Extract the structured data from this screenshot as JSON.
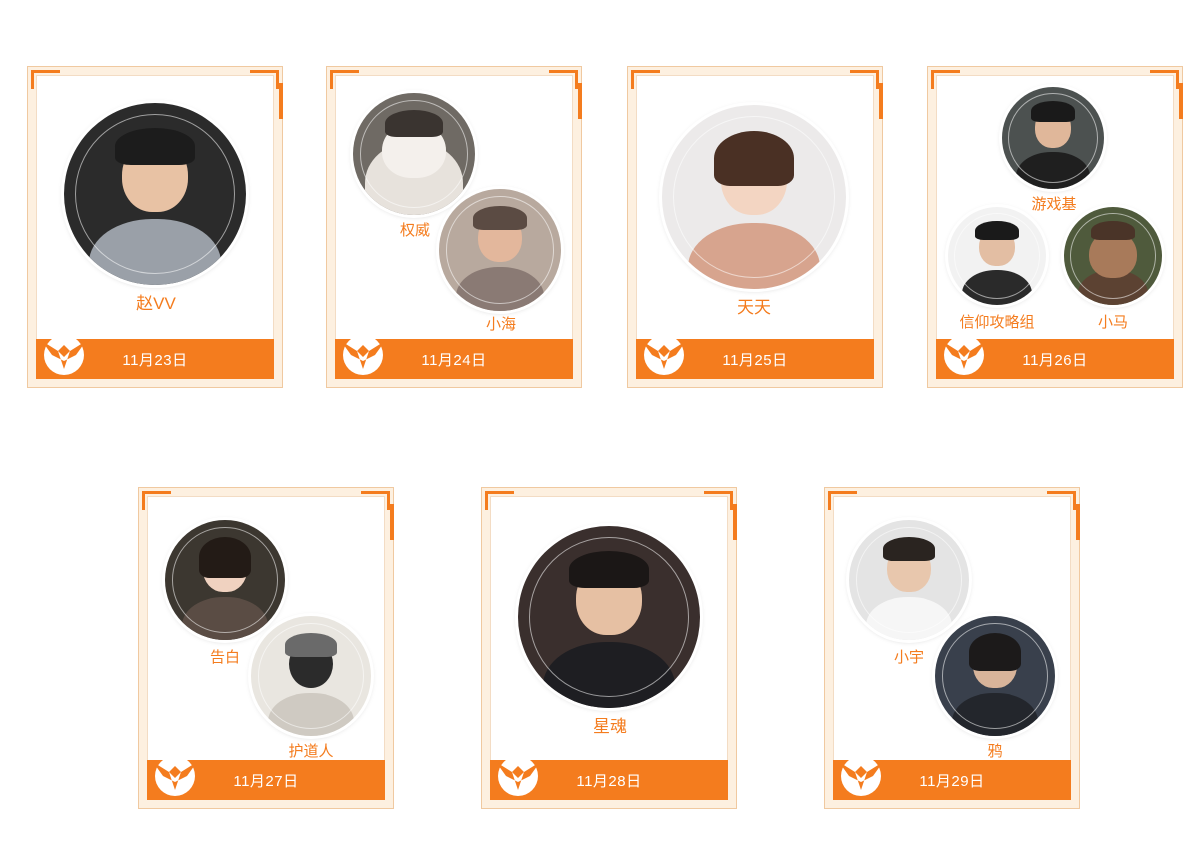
{
  "colors": {
    "accent": "#f47c1e",
    "frame": "#fdf0e0"
  },
  "cards": [
    {
      "date": "11月23日",
      "guests": [
        {
          "name": "赵VV"
        }
      ]
    },
    {
      "date": "11月24日",
      "guests": [
        {
          "name": "权威"
        },
        {
          "name": "小海"
        }
      ]
    },
    {
      "date": "11月25日",
      "guests": [
        {
          "name": "天天"
        }
      ]
    },
    {
      "date": "11月26日",
      "guests": [
        {
          "name": "游戏基"
        },
        {
          "name": "信仰攻略组"
        },
        {
          "name": "小马"
        }
      ]
    },
    {
      "date": "11月27日",
      "guests": [
        {
          "name": "告白"
        },
        {
          "name": "护道人"
        }
      ]
    },
    {
      "date": "11月28日",
      "guests": [
        {
          "name": "星魂"
        }
      ]
    },
    {
      "date": "11月29日",
      "guests": [
        {
          "name": "小宇"
        },
        {
          "name": "鸦"
        }
      ]
    }
  ]
}
